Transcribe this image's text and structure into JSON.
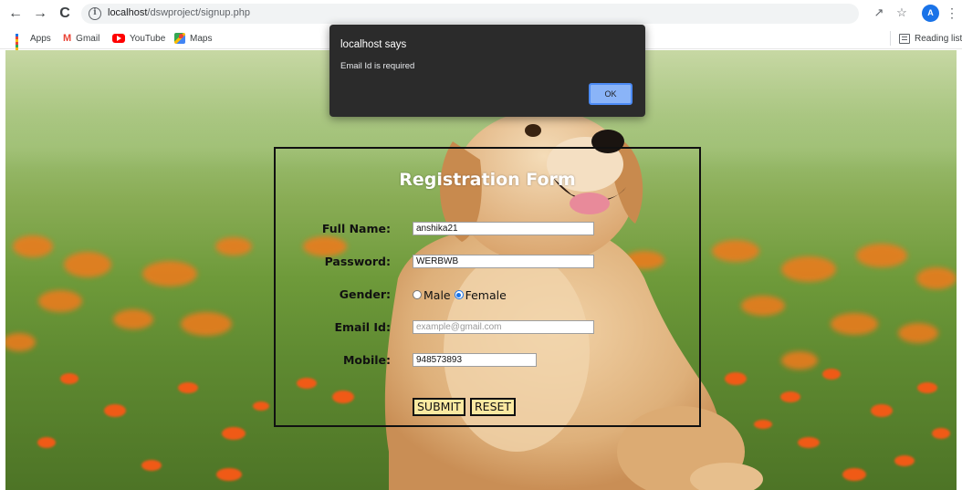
{
  "browser": {
    "url_host": "localhost",
    "url_path": "/dswproject/signup.php",
    "avatar_letter": "A",
    "bookmarks": [
      "Apps",
      "Gmail",
      "YouTube",
      "Maps"
    ],
    "reading_list": "Reading list"
  },
  "dialog": {
    "title": "localhost says",
    "message": "Email Id is required",
    "ok_label": "OK"
  },
  "form": {
    "title": "Registration Form",
    "full_name_label": "Full Name:",
    "full_name_value": "anshika21",
    "password_label": "Password:",
    "password_value": "WERBWB",
    "gender_label": "Gender:",
    "gender_options": [
      "Male",
      "Female"
    ],
    "gender_selected": "Female",
    "email_label": "Email Id:",
    "email_placeholder": "example@gmail.com",
    "mobile_label": "Mobile:",
    "mobile_value": "948573893",
    "submit_label": "SUBMIT",
    "reset_label": "RESET"
  },
  "colors": {
    "dialog_bg": "#2b2b2b",
    "ok_button": "#8ab4f8",
    "form_button_bg": "#fbe9a1",
    "avatar": "#1a73e8",
    "title_text": "#ffffff"
  },
  "icons": [
    "back-arrow-icon",
    "forward-arrow-icon",
    "reload-icon",
    "info-icon",
    "share-icon",
    "star-icon",
    "kebab-menu-icon",
    "apps-grid-icon",
    "gmail-icon",
    "youtube-icon",
    "maps-icon",
    "reading-list-icon"
  ]
}
